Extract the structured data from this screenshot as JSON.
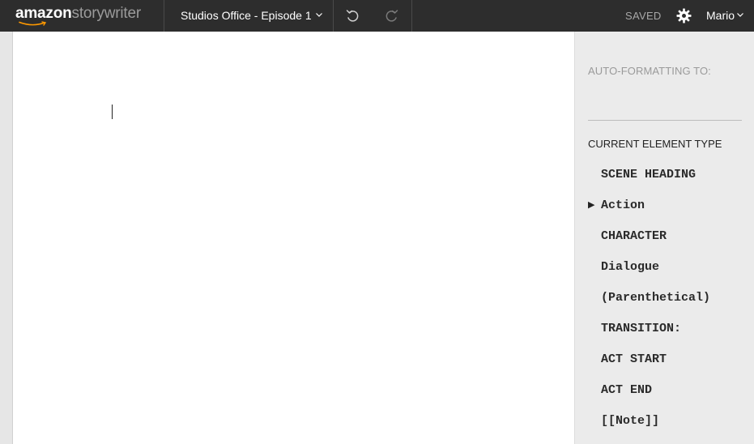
{
  "header": {
    "logo_brand": "amazon",
    "logo_product": "storywriter",
    "project_title": "Studios Office - Episode 1",
    "save_status": "SAVED",
    "user_name": "Mario"
  },
  "icons": {
    "undo": "undo-icon",
    "redo": "redo-icon",
    "settings": "gear-icon",
    "dropdown": "chevron-down-icon"
  },
  "colors": {
    "topbar": "#2d2d2d",
    "page": "#ffffff",
    "panel": "#ebebeb",
    "muted_text": "#9a9a9a"
  },
  "panel": {
    "autoformat_label": "AUTO-FORMATTING TO:",
    "autoformat_value": "",
    "current_element_label": "CURRENT ELEMENT TYPE",
    "current_index": 1,
    "elements": [
      {
        "label": "SCENE HEADING"
      },
      {
        "label": "Action"
      },
      {
        "label": "CHARACTER"
      },
      {
        "label": "Dialogue"
      },
      {
        "label": "(Parenthetical)"
      },
      {
        "label": "TRANSITION:"
      },
      {
        "label": "ACT START"
      },
      {
        "label": "ACT END"
      },
      {
        "label": "[[Note]]"
      }
    ]
  }
}
